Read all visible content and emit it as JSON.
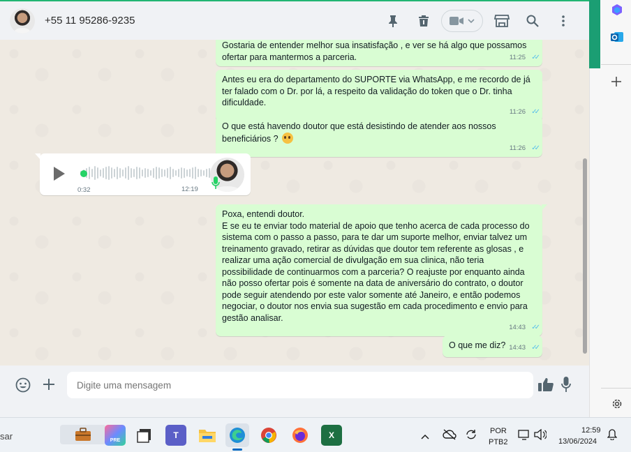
{
  "header": {
    "contact_name": "+55 11 95286-9235"
  },
  "messages": [
    {
      "id": "b1",
      "text": "Gostaria de entender melhor sua insatisfação , e ver se há algo que possamos ofertar para mantermos a parceria.",
      "time": "11:25"
    },
    {
      "id": "b2",
      "text": "Antes eu era do departamento do SUPORTE via WhatsApp, e me recordo de já ter falado com o Dr. por lá, a respeito da validação do token que o Dr. tinha dificuldade.",
      "time": "11:26"
    },
    {
      "id": "b3",
      "text": "O que está havendo doutor que está desistindo de atender aos nossos beneficiários ?",
      "time": "11:26"
    },
    {
      "id": "b5",
      "text": "Poxa, entendi doutor.\nE se eu te enviar todo material de apoio que tenho acerca de cada processo do sistema com o passo a passo, para te dar um suporte melhor, enviar talvez um treinamento gravado, retirar as dúvidas que doutor tem referente as glosas , e realizar uma ação comercial de divulgação em sua clinica, não teria possibilidade de continuarmos com a parceria? O reajuste por enquanto ainda não posso ofertar pois é somente na data de aniversário do contrato, o doutor pode seguir atendendo por este valor somente até Janeiro, e então podemos negociar, o doutor nos envia sua sugestão em cada procedimento e envio para gestão analisar.",
      "time": "14:43"
    },
    {
      "id": "b6",
      "text": "O que me diz?",
      "time": "14:43"
    }
  ],
  "voice_message": {
    "duration": "0:32",
    "time": "12:19",
    "progress": 0.0
  },
  "compose": {
    "placeholder": "Digite uma mensagem"
  },
  "taskbar": {
    "search_text": "sar",
    "lang_line1": "POR",
    "lang_line2": "PTB2",
    "clock": "12:59",
    "date": "13/06/2024",
    "apps": [
      "work-briefcase",
      "copilot-pre",
      "app-square",
      "teams",
      "file-explorer",
      "edge",
      "chrome",
      "firefox",
      "excel"
    ]
  },
  "colors": {
    "outgoing_bubble": "#d9fdd3",
    "read_ticks": "#53bdeb",
    "accent_green": "#25d366"
  }
}
